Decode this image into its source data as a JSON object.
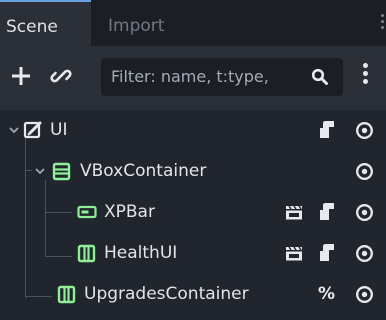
{
  "tabs": {
    "scene_label": "Scene",
    "import_label": "Import"
  },
  "toolbar": {
    "filter_placeholder": "Filter: name, t:type,"
  },
  "tree": {
    "nodes": [
      {
        "label": "UI",
        "type_icon": "control-edit-icon",
        "right_icons": [
          "script-icon",
          "visibility-eye-icon"
        ]
      },
      {
        "label": "VBoxContainer",
        "type_icon": "vbox-container-icon",
        "right_icons": [
          "visibility-eye-icon"
        ]
      },
      {
        "label": "XPBar",
        "type_icon": "progress-bar-icon",
        "right_icons": [
          "clapperboard-icon",
          "script-icon",
          "visibility-eye-icon"
        ]
      },
      {
        "label": "HealthUI",
        "type_icon": "hbox-container-icon",
        "right_icons": [
          "clapperboard-icon",
          "script-icon",
          "visibility-eye-icon"
        ]
      },
      {
        "label": "UpgradesContainer",
        "type_icon": "hbox-container-icon",
        "right_icons": [
          "unique-name-percent-icon",
          "visibility-eye-icon"
        ]
      }
    ],
    "unique_name_marker": "%"
  },
  "colors": {
    "background": "#21262e",
    "toolbar": "#2a2f38",
    "tab_accent": "#6aa1e0",
    "container_green": "#8eef97",
    "text": "#e1e5ea"
  }
}
